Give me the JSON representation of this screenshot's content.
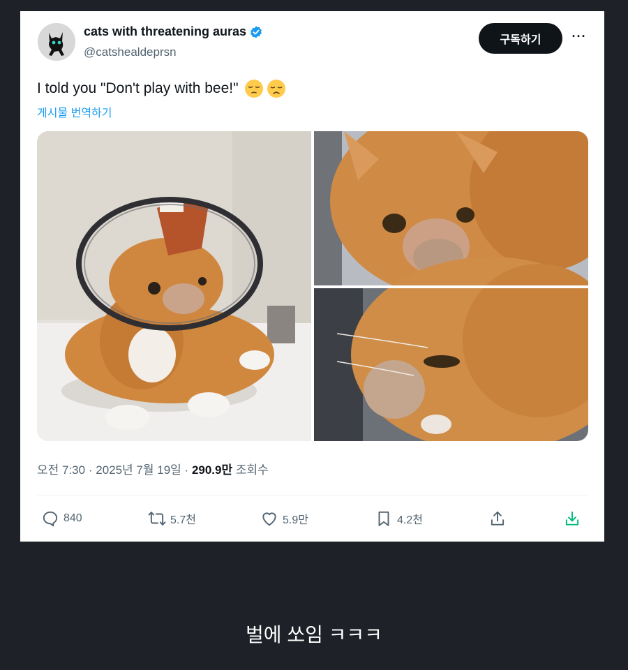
{
  "tweet": {
    "display_name": "cats with threatening auras",
    "handle": "@catshealdeprsn",
    "subscribe_label": "구독하기",
    "more_label": "···",
    "text": "I told you \"Don't play with bee!\"",
    "emojis": [
      "pensive-face-emoji",
      "disappointed-face-emoji"
    ],
    "translate_label": "게시물 번역하기",
    "meta": {
      "time": "오전 7:30",
      "sep1": "·",
      "date": "2025년 7월 19일",
      "sep2": "·",
      "views_value": "290.9만",
      "views_label": "조회수"
    },
    "actions": {
      "replies": "840",
      "reposts": "5.7천",
      "likes": "5.9만",
      "bookmarks": "4.2천"
    },
    "colors": {
      "accent": "#1d9bf0",
      "text": "#0f1419",
      "muted": "#536471",
      "download": "#00ba7c"
    }
  },
  "caption": "벌에 쏘임 ㅋㅋㅋ",
  "page_background": "#1e2228"
}
